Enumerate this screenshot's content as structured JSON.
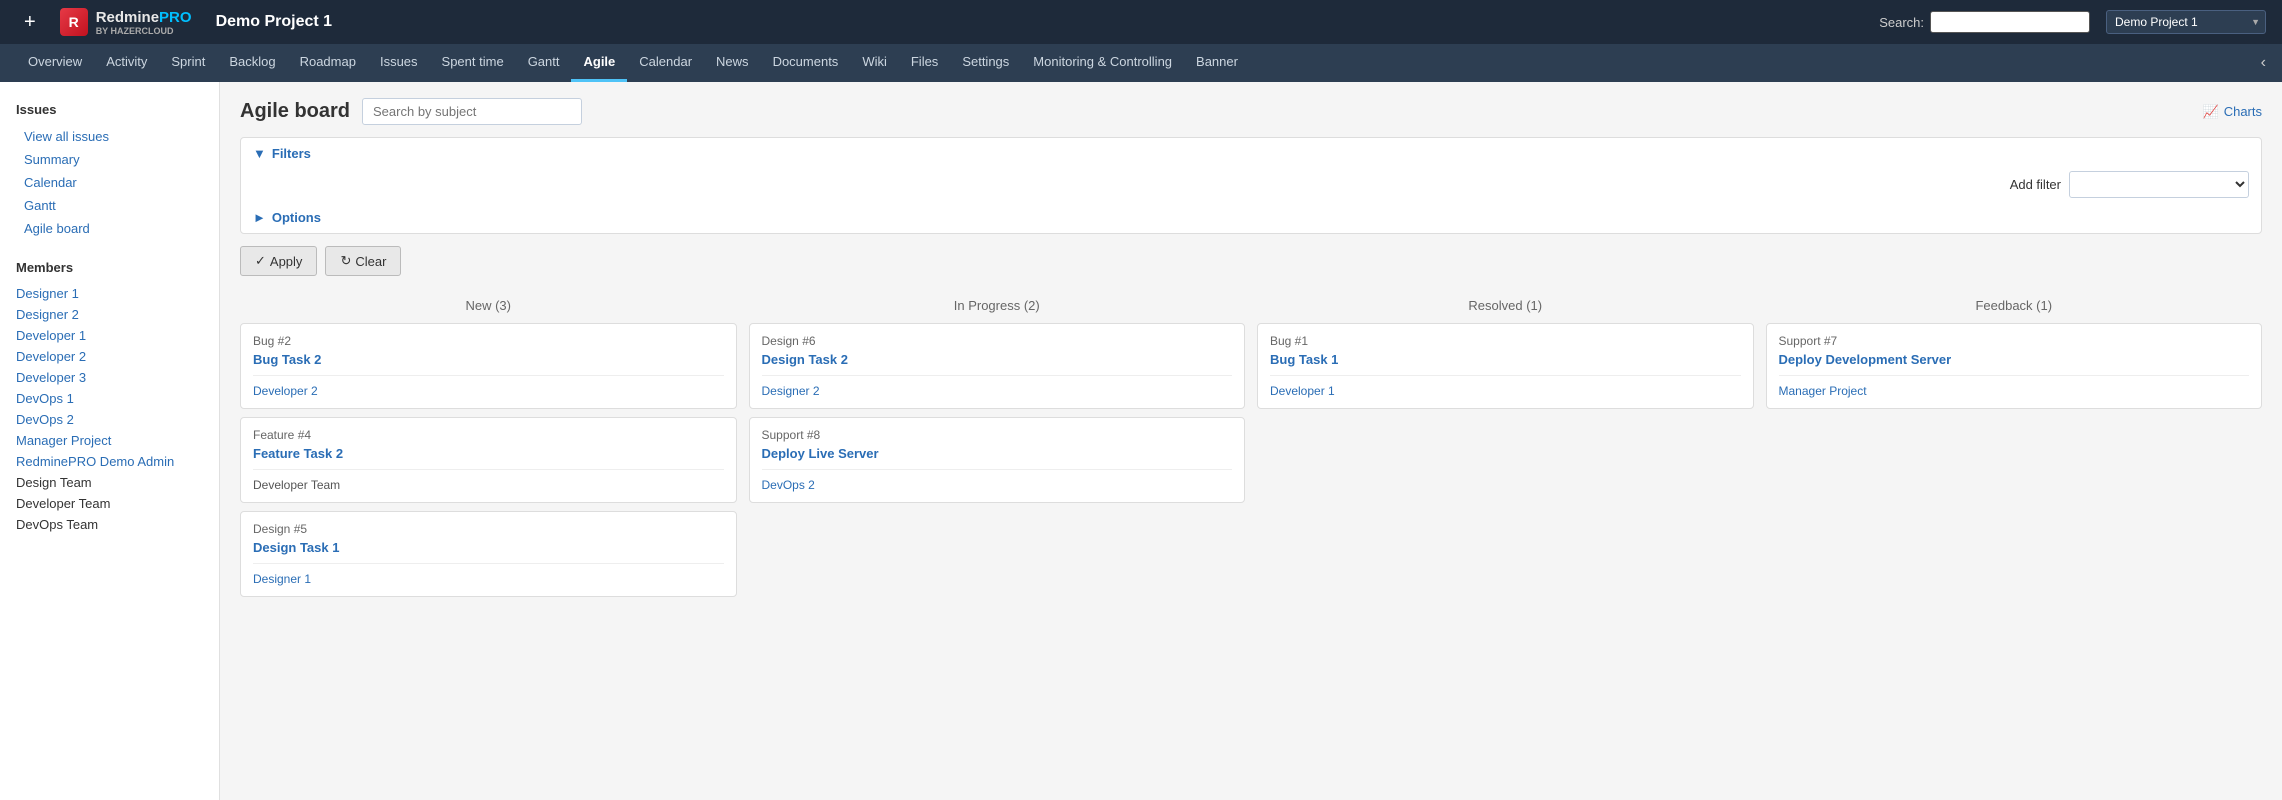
{
  "header": {
    "logo_text": "Redmine",
    "logo_pro": "PRO",
    "logo_sub": "BY HAZERCLOUD",
    "project_title": "Demo Project 1",
    "search_label": "Search:",
    "search_placeholder": "",
    "project_select": "Demo Project 1",
    "add_btn": "+"
  },
  "nav": {
    "items": [
      {
        "id": "overview",
        "label": "Overview",
        "active": false
      },
      {
        "id": "activity",
        "label": "Activity",
        "active": false
      },
      {
        "id": "sprint",
        "label": "Sprint",
        "active": false
      },
      {
        "id": "backlog",
        "label": "Backlog",
        "active": false
      },
      {
        "id": "roadmap",
        "label": "Roadmap",
        "active": false
      },
      {
        "id": "issues",
        "label": "Issues",
        "active": false
      },
      {
        "id": "spent-time",
        "label": "Spent time",
        "active": false
      },
      {
        "id": "gantt",
        "label": "Gantt",
        "active": false
      },
      {
        "id": "agile",
        "label": "Agile",
        "active": true
      },
      {
        "id": "calendar",
        "label": "Calendar",
        "active": false
      },
      {
        "id": "news",
        "label": "News",
        "active": false
      },
      {
        "id": "documents",
        "label": "Documents",
        "active": false
      },
      {
        "id": "wiki",
        "label": "Wiki",
        "active": false
      },
      {
        "id": "files",
        "label": "Files",
        "active": false
      },
      {
        "id": "settings",
        "label": "Settings",
        "active": false
      },
      {
        "id": "monitoring",
        "label": "Monitoring & Controlling",
        "active": false
      },
      {
        "id": "banner",
        "label": "Banner",
        "active": false
      }
    ]
  },
  "sidebar": {
    "issues_heading": "Issues",
    "links": [
      {
        "id": "view-all-issues",
        "label": "View all issues"
      },
      {
        "id": "summary",
        "label": "Summary"
      },
      {
        "id": "calendar",
        "label": "Calendar"
      },
      {
        "id": "gantt",
        "label": "Gantt"
      },
      {
        "id": "agile-board",
        "label": "Agile board"
      }
    ],
    "members_heading": "Members",
    "members": [
      {
        "id": "designer-1",
        "label": "Designer 1",
        "plain": false
      },
      {
        "id": "designer-2",
        "label": "Designer 2",
        "plain": false
      },
      {
        "id": "developer-1",
        "label": "Developer 1",
        "plain": false
      },
      {
        "id": "developer-2",
        "label": "Developer 2",
        "plain": false
      },
      {
        "id": "developer-3",
        "label": "Developer 3",
        "plain": false
      },
      {
        "id": "devops-1",
        "label": "DevOps 1",
        "plain": false
      },
      {
        "id": "devops-2",
        "label": "DevOps 2",
        "plain": false
      },
      {
        "id": "manager-project",
        "label": "Manager Project",
        "plain": false
      },
      {
        "id": "redminepro-demo-admin",
        "label": "RedminePRO Demo Admin",
        "plain": false
      },
      {
        "id": "design-team",
        "label": "Design Team",
        "plain": true
      },
      {
        "id": "developer-team",
        "label": "Developer Team",
        "plain": true
      },
      {
        "id": "devops-team",
        "label": "DevOps Team",
        "plain": true
      }
    ]
  },
  "main": {
    "board_title": "Agile board",
    "search_placeholder": "Search by subject",
    "charts_label": "Charts",
    "charts_icon": "📈",
    "filters": {
      "toggle_label": "Filters",
      "options_label": "Options",
      "add_filter_label": "Add filter",
      "add_filter_select_default": ""
    },
    "buttons": {
      "apply": "Apply",
      "apply_icon": "✓",
      "clear": "Clear",
      "clear_icon": "↻"
    },
    "columns": [
      {
        "id": "new",
        "label": "New (3)",
        "cards": [
          {
            "issue_id": "Bug #2",
            "title": "Bug Task 2",
            "assignee": "Developer 2",
            "assignee_link": true
          },
          {
            "issue_id": "Feature #4",
            "title": "Feature Task 2",
            "assignee": "Developer Team",
            "assignee_link": false
          },
          {
            "issue_id": "Design #5",
            "title": "Design Task 1",
            "assignee": "Designer 1",
            "assignee_link": true
          }
        ]
      },
      {
        "id": "in-progress",
        "label": "In Progress (2)",
        "cards": [
          {
            "issue_id": "Design #6",
            "title": "Design Task 2",
            "assignee": "Designer 2",
            "assignee_link": true
          },
          {
            "issue_id": "Support #8",
            "title": "Deploy Live Server",
            "assignee": "DevOps 2",
            "assignee_link": true
          }
        ]
      },
      {
        "id": "resolved",
        "label": "Resolved (1)",
        "cards": [
          {
            "issue_id": "Bug #1",
            "title": "Bug Task 1",
            "assignee": "Developer 1",
            "assignee_link": true
          }
        ]
      },
      {
        "id": "feedback",
        "label": "Feedback (1)",
        "cards": [
          {
            "issue_id": "Support #7",
            "title": "Deploy Development Server",
            "assignee": "Manager Project",
            "assignee_link": true
          }
        ]
      }
    ]
  }
}
